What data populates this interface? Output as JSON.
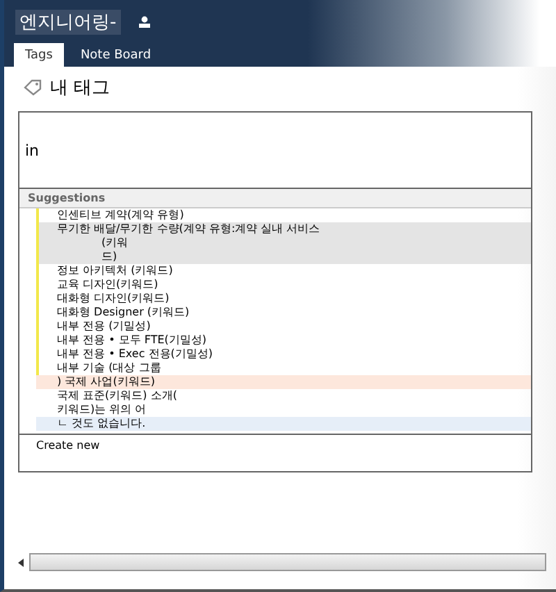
{
  "site": {
    "title": "엔지니어링-"
  },
  "tabs": [
    {
      "label": "Tags",
      "selected": true
    },
    {
      "label": "Note Board",
      "selected": false
    }
  ],
  "heading": "내 태그",
  "tag_input": {
    "value": "in"
  },
  "suggestions": {
    "title": "Suggestions",
    "items": [
      {
        "lines": [
          "인센티브 계약(계약 유형)"
        ],
        "marked": true,
        "kind": "plain"
      },
      {
        "lines": [
          "무기한 배달/무기한 수량(계약 유형:계약 실내 서비스",
          "(키워",
          "드)"
        ],
        "marked": true,
        "kind": "gray"
      },
      {
        "lines": [
          "정보 아키텍처 (키워드)"
        ],
        "marked": true,
        "kind": "plain"
      },
      {
        "lines": [
          "교육 디자인(키워드)"
        ],
        "marked": true,
        "kind": "plain"
      },
      {
        "lines": [
          "대화형 디자인(키워드)"
        ],
        "marked": true,
        "kind": "plain"
      },
      {
        "lines": [
          "대화형 Designer (키워드)"
        ],
        "marked": true,
        "kind": "plain"
      },
      {
        "lines": [
          "내부 전용 (기밀성)"
        ],
        "marked": true,
        "kind": "plain"
      },
      {
        "lines": [
          "내부 전용 • 모두        FTE(기밀성)"
        ],
        "marked": true,
        "kind": "plain"
      },
      {
        "lines": [
          "내부 전용 •          Exec 전용(기밀성)"
        ],
        "marked": true,
        "kind": "plain"
      },
      {
        "lines": [
          "내부 기술 (대상 그룹"
        ],
        "marked": true,
        "kind": "plain"
      },
      {
        "lines": [
          ") 국제 사업(키워드)"
        ],
        "marked": false,
        "kind": "orange"
      },
      {
        "lines": [
          "국제 표준(키워드) 소개("
        ],
        "marked": false,
        "kind": "plain"
      },
      {
        "lines": [
          "키워드)는 위의 어"
        ],
        "marked": false,
        "kind": "plain"
      },
      {
        "lines": [
          "ㄴ 것도 없습니다."
        ],
        "marked": false,
        "kind": "blue"
      }
    ],
    "create": "Create new"
  }
}
